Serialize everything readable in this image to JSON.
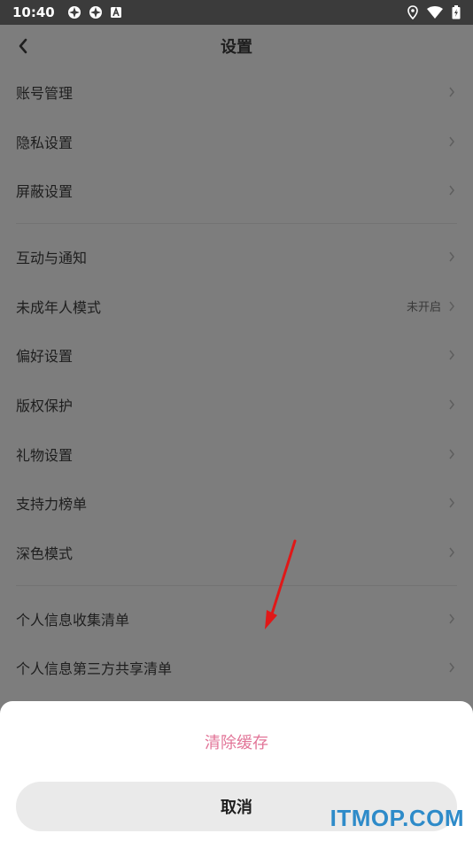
{
  "status_bar": {
    "time": "10:40",
    "icons_left": [
      "app-icon",
      "app-icon",
      "notification-icon"
    ],
    "icons_right": [
      "location-icon",
      "wifi-icon",
      "battery-icon"
    ]
  },
  "header": {
    "title": "设置",
    "back_icon": "chevron-left-icon"
  },
  "settings": {
    "group1": [
      {
        "label": "账号管理"
      },
      {
        "label": "隐私设置"
      },
      {
        "label": "屏蔽设置"
      }
    ],
    "group2": [
      {
        "label": "互动与通知"
      },
      {
        "label": "未成年人模式",
        "value": "未开启"
      },
      {
        "label": "偏好设置"
      },
      {
        "label": "版权保护"
      },
      {
        "label": "礼物设置"
      },
      {
        "label": "支持力榜单"
      },
      {
        "label": "深色模式"
      }
    ],
    "group3": [
      {
        "label": "个人信息收集清单"
      },
      {
        "label": "个人信息第三方共享清单"
      }
    ]
  },
  "sheet": {
    "clear_cache_label": "清除缓存",
    "cancel_label": "取消"
  },
  "watermark": "ITMOP.COM",
  "colors": {
    "accent": "#e27598",
    "overlay": "#7d7d7d",
    "status_bar": "#3b3b3b",
    "annotation_arrow": "#e01818",
    "watermark": "#2e8bc9"
  }
}
